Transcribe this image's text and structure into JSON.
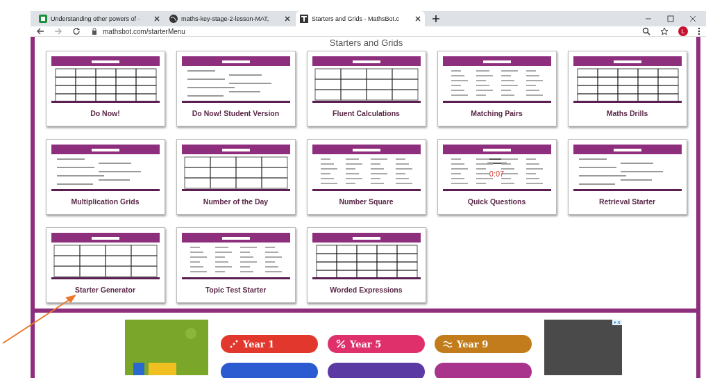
{
  "browser": {
    "tabs": [
      {
        "title": "Understanding other powers of ·",
        "selected": false
      },
      {
        "title": "maths-key-stage-2-lesson-MAT,",
        "selected": false
      },
      {
        "title": "Starters and Grids - MathsBot.c",
        "selected": true
      }
    ],
    "url": "mathsbot.com/starterMenu",
    "profile": "L"
  },
  "page": {
    "heading": "Starters and Grids",
    "cards": [
      {
        "title": "Do Now!"
      },
      {
        "title": "Do Now! Student Version"
      },
      {
        "title": "Fluent Calculations"
      },
      {
        "title": "Matching Pairs"
      },
      {
        "title": "Maths Drills"
      },
      {
        "title": "Multiplication Grids"
      },
      {
        "title": "Number of the Day"
      },
      {
        "title": "Number Square"
      },
      {
        "title": "Quick Questions",
        "timer": "0:07"
      },
      {
        "title": "Retrieval Starter"
      },
      {
        "title": "Starter Generator"
      },
      {
        "title": "Topic Test Starter"
      },
      {
        "title": "Worded Expressions"
      }
    ]
  },
  "ad": {
    "buttons": [
      {
        "label": "Year 1",
        "color": "#e2372c"
      },
      {
        "label": "Year 5",
        "color": "#e0306c"
      },
      {
        "label": "Year 9",
        "color": "#c27c1c"
      },
      {
        "color": "#2c5ad0"
      },
      {
        "color": "#5c3aa4"
      },
      {
        "color": "#a8348c"
      }
    ]
  }
}
